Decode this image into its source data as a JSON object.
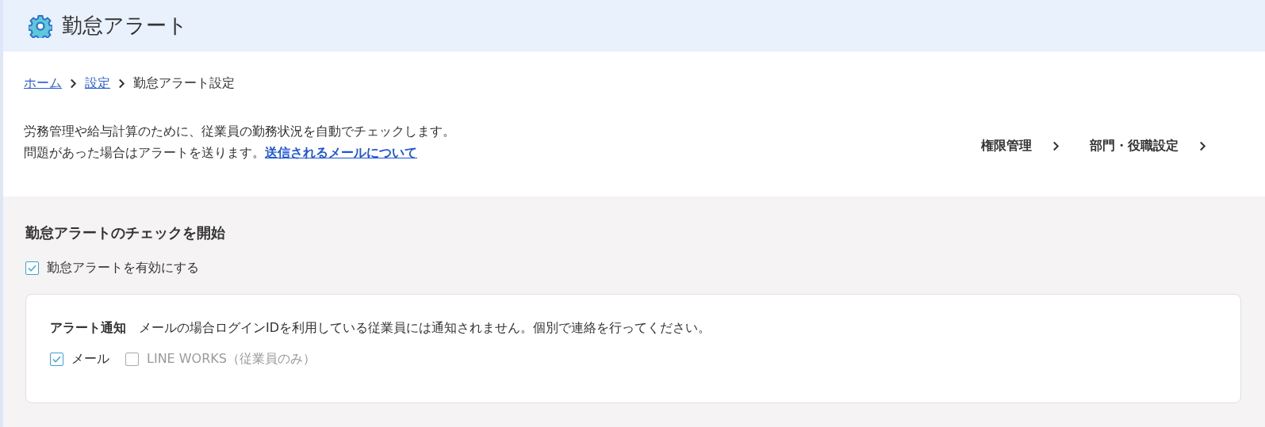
{
  "header": {
    "title": "勤怠アラート"
  },
  "breadcrumb": [
    {
      "label": "ホーム",
      "kind": "link"
    },
    {
      "label": "設定",
      "kind": "link"
    },
    {
      "label": "勤怠アラート設定",
      "kind": "current"
    }
  ],
  "description": {
    "line1": "労務管理や給与計算のために、従業員の勤務状況を自動でチェックします。",
    "line2": "問題があった場合はアラートを送ります。",
    "link": "送信されるメールについて"
  },
  "nav_links": [
    {
      "label": "権限管理"
    },
    {
      "label": "部門・役職設定"
    }
  ],
  "section": {
    "heading": "勤怠アラートのチェックを開始",
    "enable": {
      "label": "勤怠アラートを有効にする",
      "checked": true
    },
    "card": {
      "label": "アラート通知",
      "note": "メールの場合ログインIDを利用している従業員には通知されません。個別で連絡を行ってください。",
      "options": [
        {
          "label": "メール",
          "checked": true,
          "disabled": false
        },
        {
          "label": "LINE WORKS（従業員のみ）",
          "checked": false,
          "disabled": true
        }
      ]
    }
  }
}
